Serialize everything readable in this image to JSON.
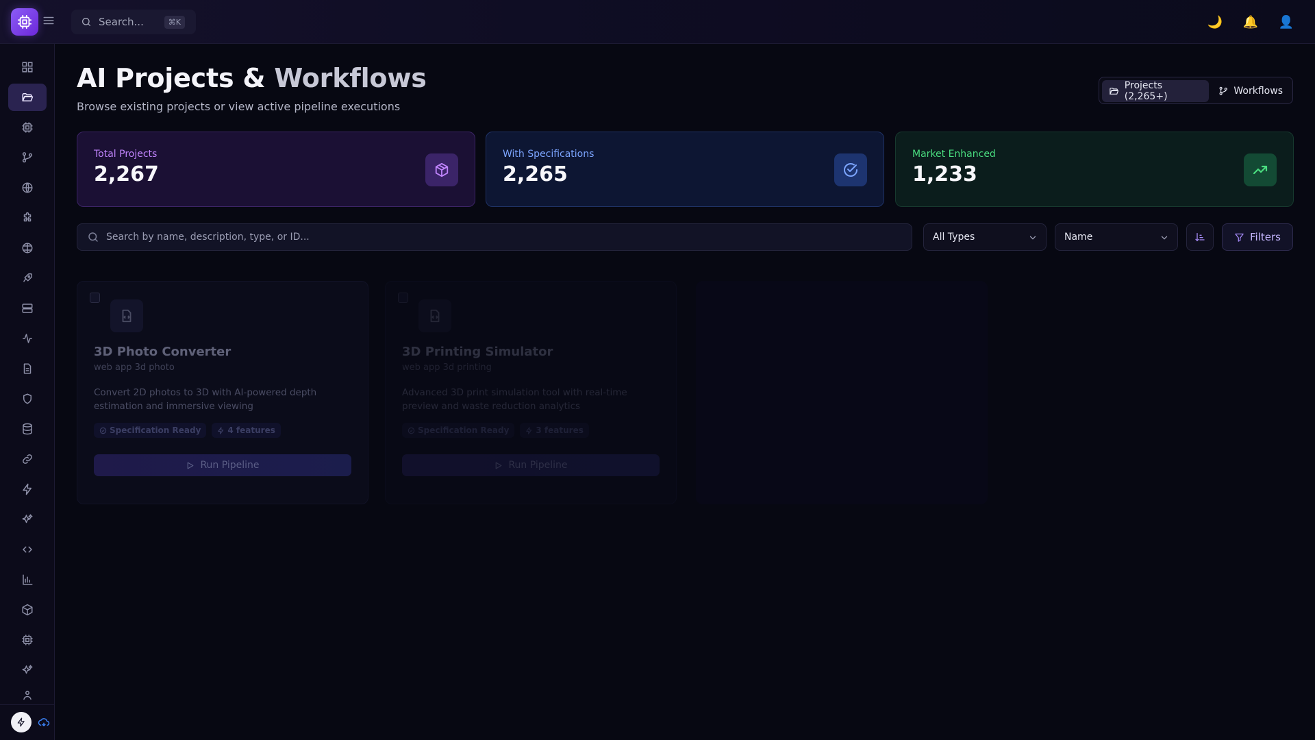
{
  "topbar": {
    "search_label": "Search...",
    "search_shortcut": "⌘K",
    "icons": [
      "moon-icon",
      "bell-icon",
      "user-icon"
    ]
  },
  "sidebar": {
    "items": [
      {
        "icon": "dashboard-icon",
        "active": false
      },
      {
        "icon": "folder-open-icon",
        "active": true
      },
      {
        "icon": "cpu-icon",
        "active": false
      },
      {
        "icon": "git-branch-icon",
        "active": false
      },
      {
        "icon": "globe-icon",
        "active": false
      },
      {
        "icon": "puzzle-icon",
        "active": false
      },
      {
        "icon": "globe-alt-icon",
        "active": false
      },
      {
        "icon": "rocket-icon",
        "active": false
      },
      {
        "icon": "server-icon",
        "active": false
      },
      {
        "icon": "activity-icon",
        "active": false
      },
      {
        "icon": "document-icon",
        "active": false
      },
      {
        "icon": "shield-icon",
        "active": false
      },
      {
        "icon": "database-icon",
        "active": false
      },
      {
        "icon": "link-icon",
        "active": false
      },
      {
        "icon": "zap-icon",
        "active": false
      },
      {
        "icon": "sparkles-icon",
        "active": false
      },
      {
        "icon": "code-icon",
        "active": false
      },
      {
        "icon": "bar-chart-icon",
        "active": false
      },
      {
        "icon": "package-icon",
        "active": false
      },
      {
        "icon": "chip-icon",
        "active": false
      },
      {
        "icon": "sparkles-alt-icon",
        "active": false
      },
      {
        "icon": "user-network-icon",
        "active": false
      }
    ]
  },
  "header": {
    "title_part1": "AI Projects & ",
    "title_part2": "Workflows",
    "subtitle": "Browse existing projects or view active pipeline executions",
    "toggle": {
      "projects_label": "Projects (2,265+)",
      "workflows_label": "Workflows",
      "active": "projects"
    }
  },
  "stats": [
    {
      "label": "Total Projects",
      "value": "2,267",
      "icon": "package-icon",
      "color": "#c084fc"
    },
    {
      "label": "With Specifications",
      "value": "2,265",
      "icon": "check-circle-icon",
      "color": "#7ca5ff"
    },
    {
      "label": "Market Enhanced",
      "value": "1,233",
      "icon": "trending-up-icon",
      "color": "#4ade80"
    }
  ],
  "controls": {
    "search_placeholder": "Search by name, description, type, or ID...",
    "type_select": "All Types",
    "sort_select": "Name",
    "filters_label": "Filters"
  },
  "projects": [
    {
      "title": "3D Photo Converter",
      "tags": "web app 3d photo",
      "description": "Convert 2D photos to 3D with AI-powered depth estimation and immersive viewing",
      "spec_badge": "Specification Ready",
      "features_badge": "4 features",
      "run_label": "Run Pipeline"
    },
    {
      "title": "3D Printing Simulator",
      "tags": "web app 3d printing",
      "description": "Advanced 3D print simulation tool with real-time preview and waste reduction analytics",
      "spec_badge": "Specification Ready",
      "features_badge": "3 features",
      "run_label": "Run Pipeline"
    }
  ],
  "colors": {
    "accent": "#8b5cf6",
    "background": "#070812",
    "purple_card": "#1b1034",
    "blue_card": "#0d1633",
    "green_card": "#0b1d1c"
  }
}
